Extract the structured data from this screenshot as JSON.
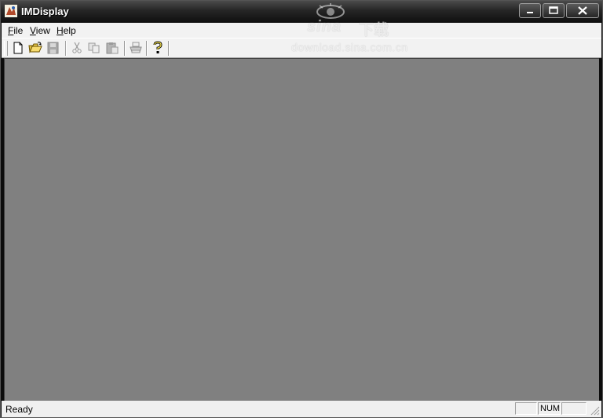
{
  "window": {
    "title": "IMDisplay",
    "buttons": {
      "minimize": "–",
      "maximize": "□",
      "close": "X"
    }
  },
  "watermark": {
    "brand": "sina",
    "sub": "下载",
    "url": "download.sina.com.cn"
  },
  "menu": {
    "items": [
      {
        "label": "File",
        "accel": "F"
      },
      {
        "label": "View",
        "accel": "V"
      },
      {
        "label": "Help",
        "accel": "H"
      }
    ]
  },
  "toolbar": {
    "buttons": [
      {
        "name": "new-file",
        "icon": "new-document-icon",
        "enabled": true
      },
      {
        "name": "open-file",
        "icon": "open-folder-icon",
        "enabled": true
      },
      {
        "name": "save-file",
        "icon": "save-disk-icon",
        "enabled": false
      },
      {
        "name": "cut",
        "icon": "scissors-icon",
        "enabled": false
      },
      {
        "name": "copy",
        "icon": "copy-icon",
        "enabled": false
      },
      {
        "name": "paste",
        "icon": "paste-clipboard-icon",
        "enabled": false
      },
      {
        "name": "print",
        "icon": "printer-icon",
        "enabled": false
      },
      {
        "name": "about",
        "icon": "help-question-icon",
        "enabled": true
      }
    ]
  },
  "status": {
    "text": "Ready",
    "num_indicator": "NUM"
  },
  "colors": {
    "client_background": "#808080",
    "titlebar": "#1e1e1e",
    "chrome": "#f2f2f2"
  }
}
